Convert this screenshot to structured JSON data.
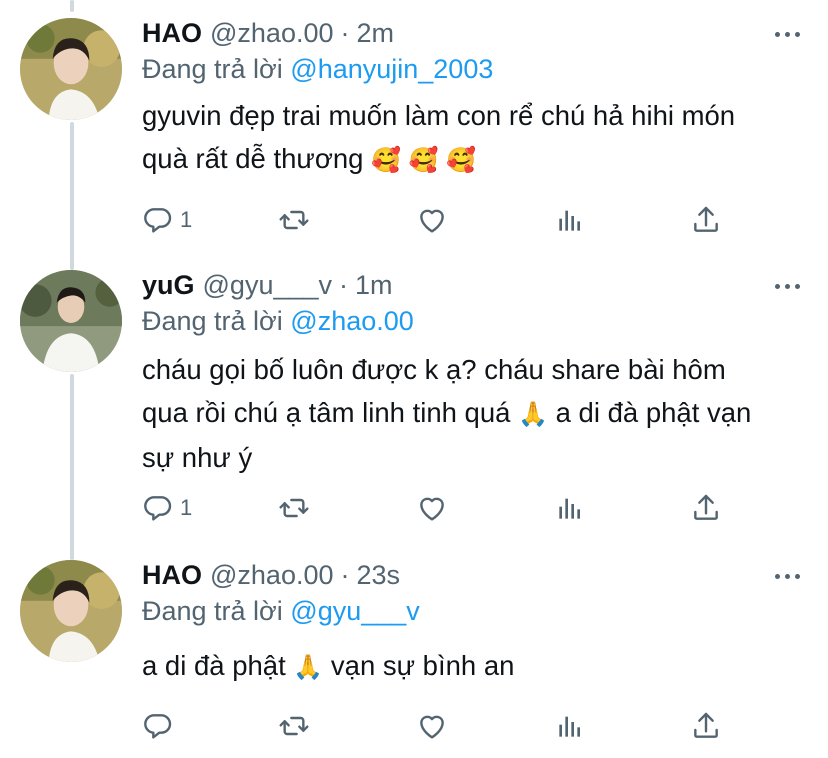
{
  "colors": {
    "text": "#0f1419",
    "muted": "#536471",
    "link": "#1d9bf0",
    "thread": "#cfd9de"
  },
  "tweets": [
    {
      "name": "HAO",
      "handle": "@zhao.00",
      "dot": "·",
      "time": "2m",
      "reply_prefix": "Đang trả lời",
      "reply_mention": "@hanyujin_2003",
      "text_line1": "gyuvin đẹp trai muốn làm con rể chú hả hihi món",
      "text_line2": "quà rất dễ thương",
      "emoji": "🥰 🥰 🥰",
      "reply_count": "1",
      "icons": [
        "reply-icon",
        "retweet-icon",
        "like-icon",
        "views-icon",
        "share-icon"
      ]
    },
    {
      "name": "yuG",
      "handle": "@gyu___v",
      "dot": "·",
      "time": "1m",
      "reply_prefix": "Đang trả lời",
      "reply_mention": "@zhao.00",
      "text_line1": "cháu gọi bố luôn được k ạ? cháu share bài hôm",
      "text_line2a": "qua rồi chú ạ tâm linh tinh quá",
      "emoji": "🙏",
      "text_line2b": "a di đà phật vạn",
      "text_line3": "sự như ý",
      "reply_count": "1",
      "icons": [
        "reply-icon",
        "retweet-icon",
        "like-icon",
        "views-icon",
        "share-icon"
      ]
    },
    {
      "name": "HAO",
      "handle": "@zhao.00",
      "dot": "·",
      "time": "23s",
      "reply_prefix": "Đang trả lời",
      "reply_mention": "@gyu___v",
      "text_line1a": "a di đà phật",
      "emoji": "🙏",
      "text_line1b": "vạn sự bình an",
      "reply_count": "",
      "icons": [
        "reply-icon",
        "retweet-icon",
        "like-icon",
        "views-icon",
        "share-icon"
      ]
    }
  ]
}
